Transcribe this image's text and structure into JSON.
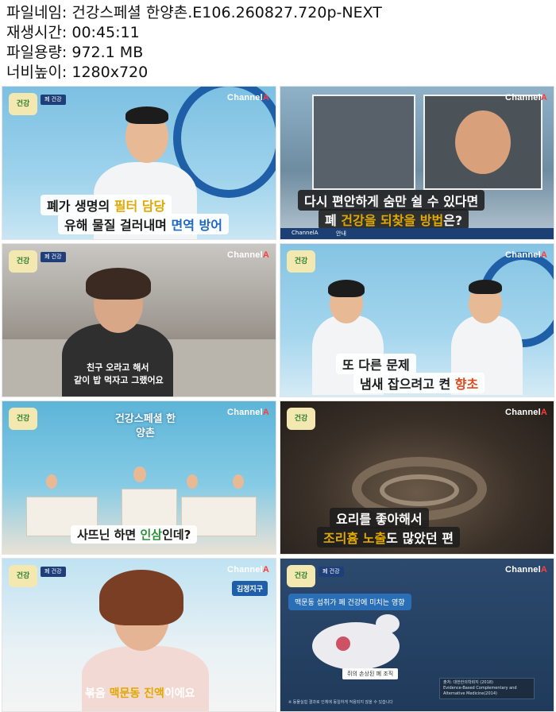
{
  "file_info": {
    "filename_label": "파일네임:",
    "filename": "건강스페셜 한양촌.E106.260827.720p-NEXT",
    "duration_label": "재생시간:",
    "duration": "00:45:11",
    "size_label": "파일용량:",
    "size": "972.1 MB",
    "resolution_label": "너비높이:",
    "resolution": "1280x720"
  },
  "branding": {
    "channel_main": "Channel",
    "channel_accent": "A",
    "show_badge": "건강\n한양촌",
    "accent_color": "#ff3b3b"
  },
  "thumbnails": [
    {
      "caption_line1_pre": "폐가 생명의 ",
      "caption_line1_hl": "필터 담당",
      "caption_line2_pre": "유해 물질 걸러내며 ",
      "caption_line2_hl": "면역 방어"
    },
    {
      "caption_line1": "다시 편안하게 숨만 쉴 수 있다면",
      "caption_line2_pre": "폐 ",
      "caption_line2_hl": "건강을 되찾을 방법",
      "caption_line2_post": "은?",
      "bottom_channel": "ChannelA",
      "bottom_tag": "안내"
    },
    {
      "caption_line1": "친구 오라고 해서",
      "caption_line2": "같이 밥 먹자고 그랬어요"
    },
    {
      "caption_line1": "또 다른 문제",
      "caption_line2_pre": "냄새 잡으려고 켠 ",
      "caption_line2_hl": "향초"
    },
    {
      "caption_pre": "사뜨닌 하면 ",
      "caption_hl": "인삼",
      "caption_post": "인데?",
      "studio_title": "건강스페셜 한양촌"
    },
    {
      "caption_line1": "요리를 좋아해서",
      "caption_line2_hl": "조리흄 노출",
      "caption_line2_post": "도 많았던 편"
    },
    {
      "caption_pre": "볶음 ",
      "caption_hl": "맥문동 진액",
      "caption_post": "이에요",
      "name_tag": "김정지구"
    },
    {
      "panel_title": "맥문동 섭취가 폐 건강에 미치는 영향",
      "mouse_label": "쥐의 손상된 폐 조직",
      "source_label": "출처: 대한한의학회지 (2018)",
      "source_detail": "Evidence-Based Complementary and Alternative Medicine(2014)",
      "footnote": "※ 동물실험 결과로 인체에 동일하게 적용되지 않을 수 있습니다"
    }
  ]
}
